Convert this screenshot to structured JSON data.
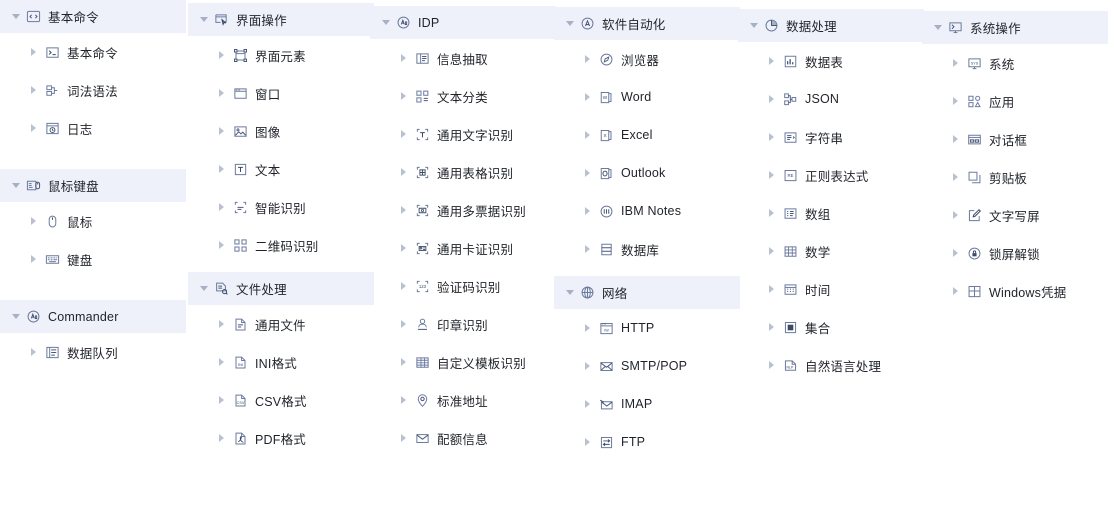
{
  "theme": {
    "header_background": "#eef1f9",
    "text_color": "#1f2329",
    "icon_stroke": "#5b6b8c",
    "caret_color": "#a7b0c6"
  },
  "columns": [
    {
      "name": "column-1",
      "groups": [
        {
          "title": "基本命令",
          "icon": "code-brackets-icon",
          "expanded": true,
          "items": [
            {
              "label": "基本命令",
              "icon": "terminal-prompt-icon"
            },
            {
              "label": "词法语法",
              "icon": "syntax-blocks-icon"
            },
            {
              "label": "日志",
              "icon": "log-clock-icon"
            }
          ]
        },
        {
          "title": "鼠标键盘",
          "icon": "mouse-keyboard-icon",
          "expanded": true,
          "items": [
            {
              "label": "鼠标",
              "icon": "mouse-icon"
            },
            {
              "label": "键盘",
              "icon": "keyboard-icon"
            }
          ]
        },
        {
          "title": "Commander",
          "icon": "ai-circle-icon",
          "expanded": true,
          "items": [
            {
              "label": "数据队列",
              "icon": "data-queue-icon"
            }
          ]
        }
      ]
    },
    {
      "name": "column-2",
      "groups": [
        {
          "title": "界面操作",
          "icon": "window-cursor-icon",
          "expanded": true,
          "items": [
            {
              "label": "界面元素",
              "icon": "ui-element-icon"
            },
            {
              "label": "窗口",
              "icon": "window-icon"
            },
            {
              "label": "图像",
              "icon": "image-icon"
            },
            {
              "label": "文本",
              "icon": "text-box-icon"
            },
            {
              "label": "智能识别",
              "icon": "smart-recognize-icon"
            },
            {
              "label": "二维码识别",
              "icon": "qr-code-icon"
            }
          ]
        },
        {
          "title": "文件处理",
          "icon": "file-process-icon",
          "expanded": true,
          "items": [
            {
              "label": "通用文件",
              "icon": "generic-file-icon"
            },
            {
              "label": "INI格式",
              "icon": "ini-file-icon"
            },
            {
              "label": "CSV格式",
              "icon": "csv-file-icon"
            },
            {
              "label": "PDF格式",
              "icon": "pdf-file-icon"
            }
          ]
        }
      ]
    },
    {
      "name": "column-3",
      "groups": [
        {
          "title": "IDP",
          "icon": "ai-circle-icon",
          "expanded": true,
          "items": [
            {
              "label": "信息抽取",
              "icon": "info-extract-icon"
            },
            {
              "label": "文本分类",
              "icon": "text-classify-icon"
            },
            {
              "label": "通用文字识别",
              "icon": "ocr-text-icon"
            },
            {
              "label": "通用表格识别",
              "icon": "ocr-table-icon"
            },
            {
              "label": "通用多票据识别",
              "icon": "ocr-receipts-icon"
            },
            {
              "label": "通用卡证识别",
              "icon": "ocr-card-icon"
            },
            {
              "label": "验证码识别",
              "icon": "captcha-icon"
            },
            {
              "label": "印章识别",
              "icon": "stamp-icon"
            },
            {
              "label": "自定义模板识别",
              "icon": "custom-template-icon"
            },
            {
              "label": "标准地址",
              "icon": "location-pin-icon"
            },
            {
              "label": "配额信息",
              "icon": "quota-envelope-icon"
            }
          ]
        }
      ]
    },
    {
      "name": "column-4",
      "groups": [
        {
          "title": "软件自动化",
          "icon": "automation-circle-icon",
          "expanded": true,
          "items": [
            {
              "label": "浏览器",
              "icon": "browser-icon"
            },
            {
              "label": "Word",
              "icon": "word-icon"
            },
            {
              "label": "Excel",
              "icon": "excel-icon"
            },
            {
              "label": "Outlook",
              "icon": "outlook-icon"
            },
            {
              "label": "IBM Notes",
              "icon": "ibm-notes-icon"
            },
            {
              "label": "数据库",
              "icon": "database-icon"
            }
          ]
        },
        {
          "title": "网络",
          "icon": "globe-icon",
          "expanded": true,
          "items": [
            {
              "label": "HTTP",
              "icon": "http-icon"
            },
            {
              "label": "SMTP/POP",
              "icon": "mail-send-icon"
            },
            {
              "label": "IMAP",
              "icon": "mail-receive-icon"
            },
            {
              "label": "FTP",
              "icon": "ftp-transfer-icon"
            }
          ]
        }
      ]
    },
    {
      "name": "column-5",
      "groups": [
        {
          "title": "数据处理",
          "icon": "pie-chart-icon",
          "expanded": true,
          "items": [
            {
              "label": "数据表",
              "icon": "data-table-icon"
            },
            {
              "label": "JSON",
              "icon": "json-node-icon"
            },
            {
              "label": "字符串",
              "icon": "string-icon"
            },
            {
              "label": "正则表达式",
              "icon": "regex-icon"
            },
            {
              "label": "数组",
              "icon": "array-icon"
            },
            {
              "label": "数学",
              "icon": "math-grid-icon"
            },
            {
              "label": "时间",
              "icon": "calendar-icon"
            },
            {
              "label": "集合",
              "icon": "set-icon"
            },
            {
              "label": "自然语言处理",
              "icon": "nlp-icon"
            }
          ]
        }
      ]
    },
    {
      "name": "column-6",
      "groups": [
        {
          "title": "系统操作",
          "icon": "monitor-icon",
          "expanded": true,
          "items": [
            {
              "label": "系统",
              "icon": "system-monitor-icon"
            },
            {
              "label": "应用",
              "icon": "apps-grid-icon"
            },
            {
              "label": "对话框",
              "icon": "dialog-icon"
            },
            {
              "label": "剪贴板",
              "icon": "clipboard-copy-icon"
            },
            {
              "label": "文字写屏",
              "icon": "screen-write-icon"
            },
            {
              "label": "锁屏解锁",
              "icon": "lock-screen-icon"
            },
            {
              "label": "Windows凭据",
              "icon": "windows-credential-icon"
            }
          ]
        }
      ]
    }
  ]
}
